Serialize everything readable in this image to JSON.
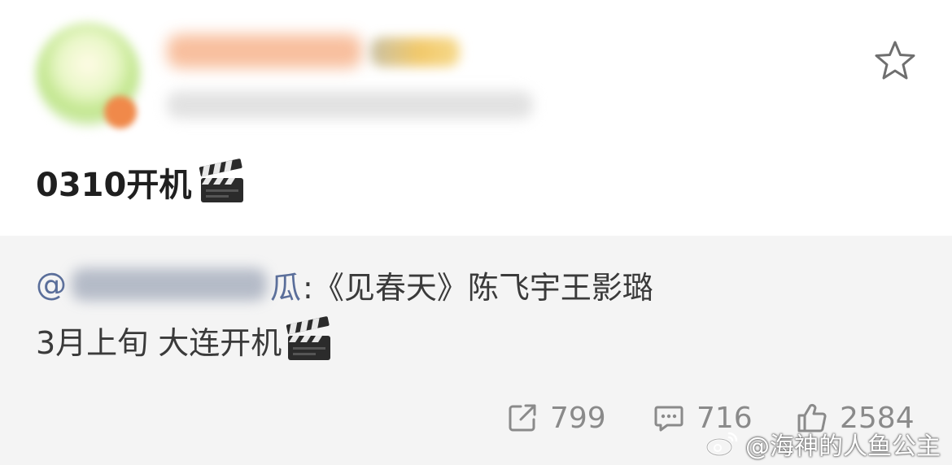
{
  "post": {
    "text": "0310开机",
    "icons": {
      "favorite": "star-outline-icon",
      "clapper": "clapperboard-icon"
    }
  },
  "repost": {
    "mention_prefix": "@",
    "mention_tail": "瓜",
    "content_line1": ":《见春天》陈飞宇王影璐",
    "content_line2": "3月上旬 大连开机"
  },
  "stats": {
    "shares": "799",
    "comments": "716",
    "likes": "2584",
    "icons": [
      "share-icon",
      "comment-icon",
      "like-icon"
    ]
  },
  "watermark": {
    "text": "@海神的人鱼公主",
    "icon": "weibo-logo-icon"
  },
  "colors": {
    "repost_background": "#f4f4f4",
    "mention_link": "#5a6e9a",
    "stats_gray": "#8a8a8a"
  }
}
